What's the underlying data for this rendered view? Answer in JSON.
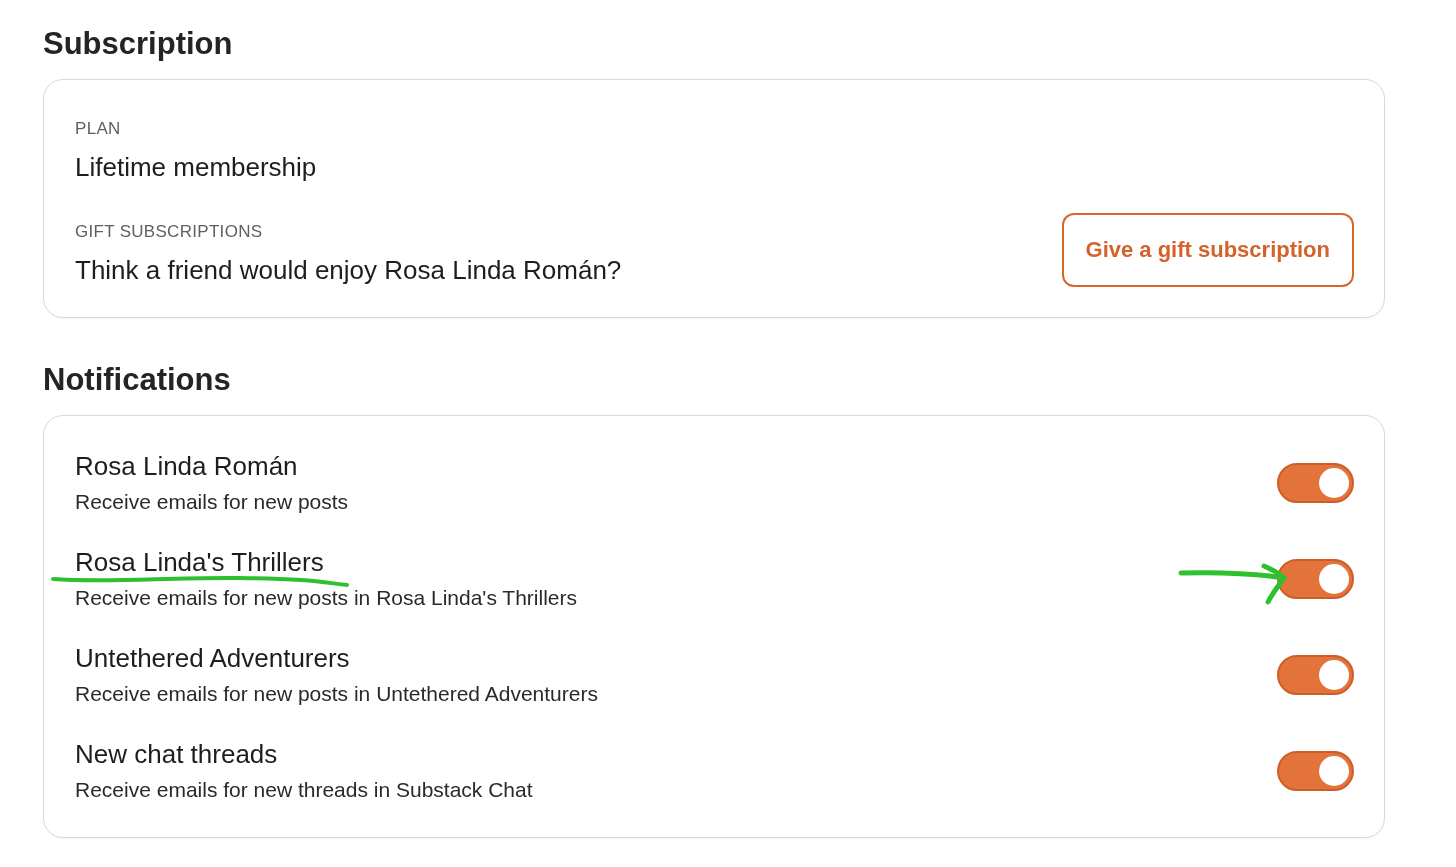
{
  "subscription": {
    "title": "Subscription",
    "fields": [
      {
        "label": "PLAN",
        "value": "Lifetime membership"
      },
      {
        "label": "GIFT SUBSCRIPTIONS",
        "value": "Think a friend would enjoy Rosa Linda Román?",
        "button": "Give a gift subscription"
      }
    ]
  },
  "notifications": {
    "title": "Notifications",
    "items": [
      {
        "name": "Rosa Linda Román",
        "description": "Receive emails for new posts",
        "on": true,
        "annotated": false
      },
      {
        "name": "Rosa Linda's Thrillers",
        "description": "Receive emails for new posts in Rosa Linda's Thrillers",
        "on": true,
        "annotated": true
      },
      {
        "name": "Untethered Adventurers",
        "description": "Receive emails for new posts in Untethered Adventurers",
        "on": true,
        "annotated": false
      },
      {
        "name": "New chat threads",
        "description": "Receive emails for new threads in Substack Chat",
        "on": true,
        "annotated": false
      }
    ]
  }
}
